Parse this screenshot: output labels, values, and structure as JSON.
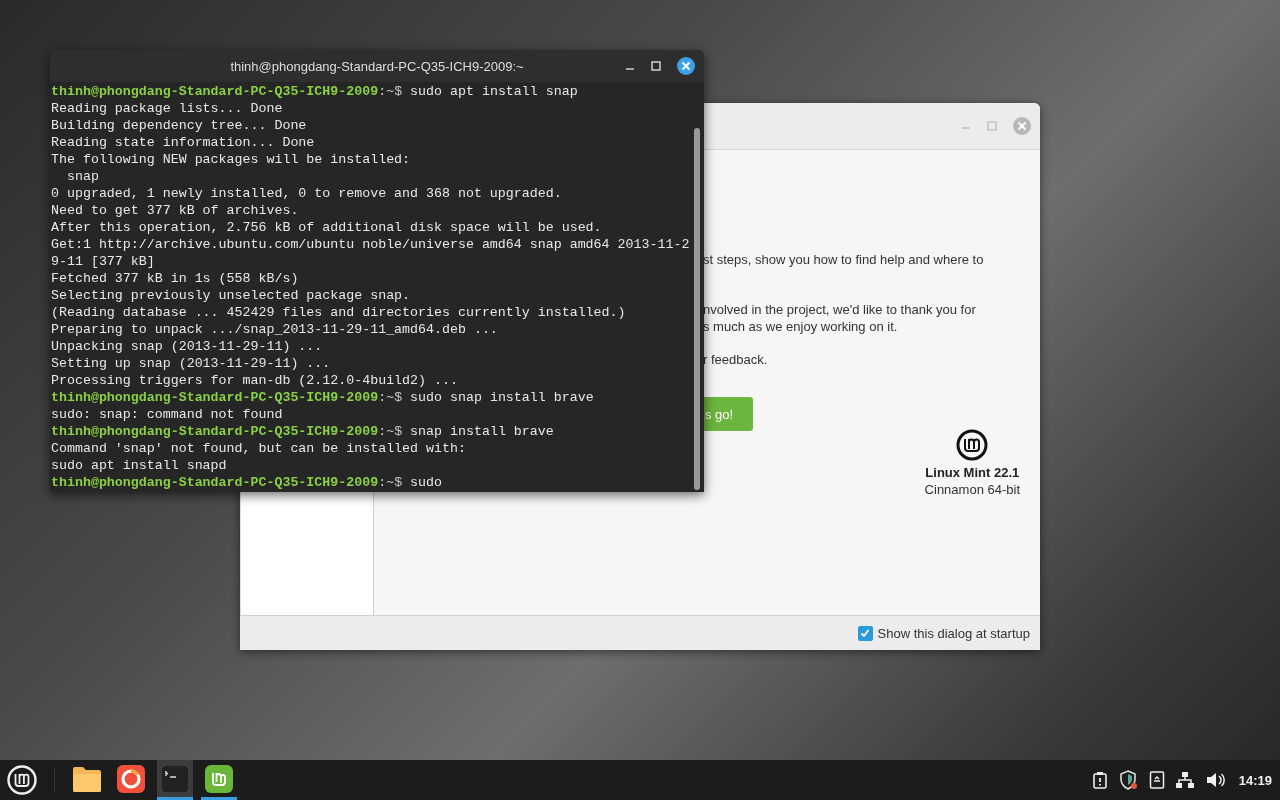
{
  "terminal": {
    "title": "thinh@phongdang-Standard-PC-Q35-ICH9-2009:~",
    "lines": [
      {
        "kind": "prompt",
        "prompt": "thinh@phongdang-Standard-PC-Q35-ICH9-2009",
        "path": ":~$",
        "command": "sudo apt install snap"
      },
      {
        "kind": "output",
        "text": "Reading package lists... Done"
      },
      {
        "kind": "output",
        "text": "Building dependency tree... Done"
      },
      {
        "kind": "output",
        "text": "Reading state information... Done"
      },
      {
        "kind": "output",
        "text": "The following NEW packages will be installed:"
      },
      {
        "kind": "output",
        "text": "  snap"
      },
      {
        "kind": "output",
        "text": "0 upgraded, 1 newly installed, 0 to remove and 368 not upgraded."
      },
      {
        "kind": "output",
        "text": "Need to get 377 kB of archives."
      },
      {
        "kind": "output",
        "text": "After this operation, 2.756 kB of additional disk space will be used."
      },
      {
        "kind": "output",
        "text": "Get:1 http://archive.ubuntu.com/ubuntu noble/universe amd64 snap amd64 2013-11-2"
      },
      {
        "kind": "output",
        "text": "9-11 [377 kB]"
      },
      {
        "kind": "output",
        "text": "Fetched 377 kB in 1s (558 kB/s)"
      },
      {
        "kind": "output",
        "text": "Selecting previously unselected package snap."
      },
      {
        "kind": "output",
        "text": "(Reading database ... 452429 files and directories currently installed.)"
      },
      {
        "kind": "output",
        "text": "Preparing to unpack .../snap_2013-11-29-11_amd64.deb ..."
      },
      {
        "kind": "output",
        "text": "Unpacking snap (2013-11-29-11) ..."
      },
      {
        "kind": "output",
        "text": "Setting up snap (2013-11-29-11) ..."
      },
      {
        "kind": "output",
        "text": "Processing triggers for man-db (2.12.0-4build2) ..."
      },
      {
        "kind": "prompt",
        "prompt": "thinh@phongdang-Standard-PC-Q35-ICH9-2009",
        "path": ":~$",
        "command": "sudo snap install brave"
      },
      {
        "kind": "output",
        "text": "sudo: snap: command not found"
      },
      {
        "kind": "prompt",
        "prompt": "thinh@phongdang-Standard-PC-Q35-ICH9-2009",
        "path": ":~$",
        "command": "snap install brave"
      },
      {
        "kind": "output",
        "text": "Command 'snap' not found, but can be installed with:"
      },
      {
        "kind": "output",
        "text": "sudo apt install snapd"
      },
      {
        "kind": "prompt",
        "prompt": "thinh@phongdang-Standard-PC-Q35-ICH9-2009",
        "path": ":~$",
        "command": "sudo"
      }
    ]
  },
  "welcome": {
    "paragraphs": [
      [
        "st steps, show you how to find help and where to"
      ],
      [
        "nvolved in the project, we'd like to thank you for",
        "s much as we enjoy working on it."
      ],
      [
        "r feedback."
      ]
    ],
    "button": "s go!",
    "product": "Linux Mint 22.1",
    "edition": "Cinnamon 64-bit",
    "startup_checkbox": {
      "label": "Show this dialog at startup",
      "checked": true
    }
  },
  "taskbar": {
    "apps": [
      {
        "kind": "folder",
        "selected": false,
        "running": false
      },
      {
        "kind": "browser",
        "selected": false,
        "running": false
      },
      {
        "kind": "terminal",
        "selected": true,
        "running": true
      },
      {
        "kind": "mint",
        "selected": false,
        "running": true
      }
    ],
    "clock": "14:19"
  }
}
